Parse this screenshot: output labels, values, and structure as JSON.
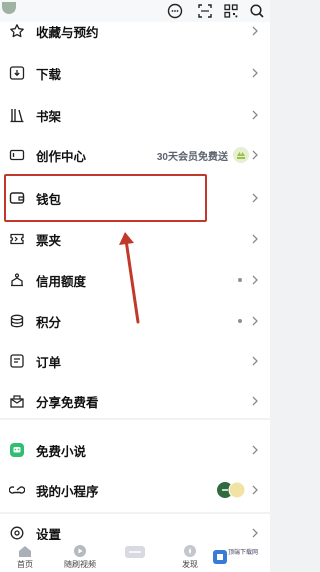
{
  "menu": [
    {
      "label": "收藏与预约",
      "icon": "star-icon"
    },
    {
      "label": "下载",
      "icon": "download-icon"
    },
    {
      "label": "书架",
      "icon": "bookshelf-icon"
    },
    {
      "label": "创作中心",
      "icon": "video-camera-icon",
      "extra": "30天会员免费送"
    },
    {
      "label": "钱包",
      "icon": "wallet-icon"
    },
    {
      "label": "票夹",
      "icon": "ticket-icon"
    },
    {
      "label": "信用额度",
      "icon": "credit-icon",
      "dot": true
    },
    {
      "label": "积分",
      "icon": "points-icon",
      "dot": true
    },
    {
      "label": "订单",
      "icon": "order-icon"
    },
    {
      "label": "分享免费看",
      "icon": "share-icon"
    },
    {
      "label": "免费小说",
      "icon": "novel-icon"
    },
    {
      "label": "我的小程序",
      "icon": "mini-program-icon"
    },
    {
      "label": "设置",
      "icon": "settings-icon"
    }
  ],
  "bottom_nav": [
    {
      "label": "首页",
      "icon": "home-icon"
    },
    {
      "label": "随刷视频",
      "icon": "video-icon"
    },
    {
      "label": "",
      "icon": "center-logo-icon"
    },
    {
      "label": "发现",
      "icon": "discover-icon"
    }
  ],
  "watermark_text": "顶端下载网",
  "colors": {
    "highlight": "#c0392b",
    "accent_green": "#2fbf71",
    "background": "#f1f2f4"
  }
}
